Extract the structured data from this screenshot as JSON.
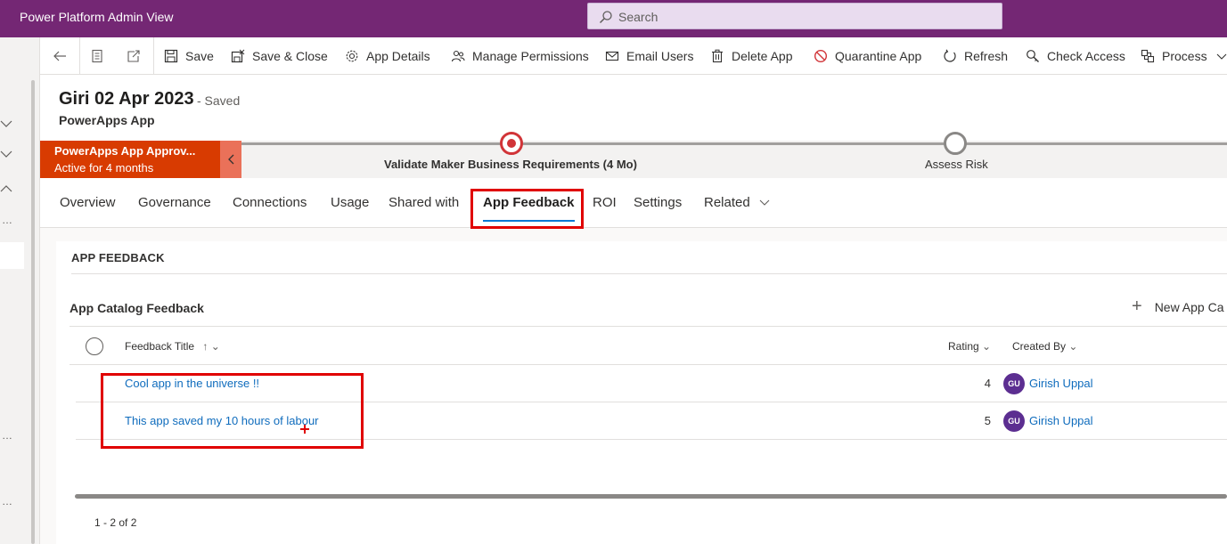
{
  "app": {
    "title": "Power Platform Admin View",
    "search_placeholder": "Search",
    "accent": "#742774"
  },
  "commands": {
    "save": "Save",
    "save_close": "Save & Close",
    "app_details": "App Details",
    "manage_permissions": "Manage Permissions",
    "email_users": "Email Users",
    "delete_app": "Delete App",
    "quarantine_app": "Quarantine App",
    "refresh": "Refresh",
    "check_access": "Check Access",
    "process": "Process"
  },
  "record": {
    "title": "Giri 02 Apr 2023",
    "saved": "- Saved",
    "entity": "PowerApps App"
  },
  "bpf": {
    "name": "PowerApps App Approv...",
    "status": "Active for 4 months",
    "stages": [
      {
        "label": "Validate Maker Business Requirements  (4 Mo)",
        "state": "active"
      },
      {
        "label": "Assess Risk",
        "state": "pending"
      }
    ]
  },
  "tabs": [
    {
      "label": "Overview"
    },
    {
      "label": "Governance"
    },
    {
      "label": "Connections"
    },
    {
      "label": "Usage"
    },
    {
      "label": "Shared with"
    },
    {
      "label": "App Feedback",
      "active": true
    },
    {
      "label": "ROI"
    },
    {
      "label": "Settings"
    },
    {
      "label": "Related"
    }
  ],
  "section": {
    "title": "APP FEEDBACK",
    "grid_title": "App Catalog Feedback",
    "new_button": "New App Ca",
    "columns": {
      "title": "Feedback Title",
      "rating": "Rating",
      "created_by": "Created By"
    },
    "rows": [
      {
        "title": "Cool app in the universe !!",
        "rating": "4",
        "initials": "GU",
        "user": "Girish Uppal"
      },
      {
        "title": "This app saved my 10 hours of labour",
        "rating": "5",
        "initials": "GU",
        "user": "Girish Uppal"
      }
    ],
    "pager": "1 - 2 of 2"
  }
}
